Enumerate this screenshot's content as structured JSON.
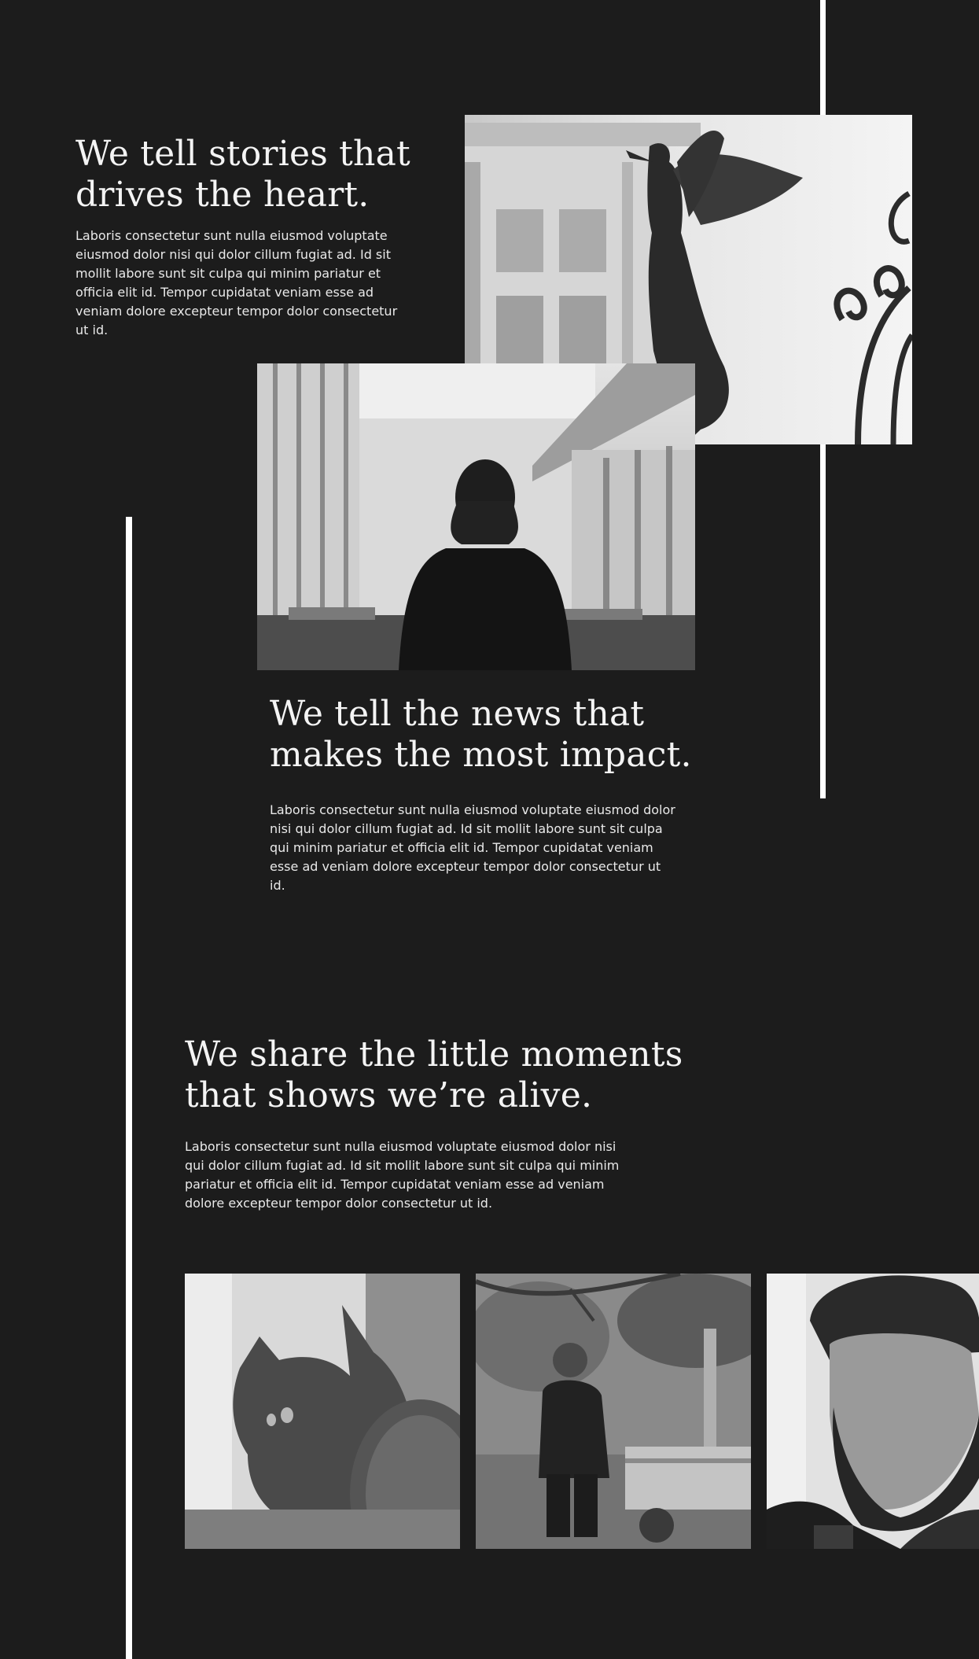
{
  "sections": [
    {
      "heading_line1": "We tell stories that",
      "heading_line2": "drives the heart.",
      "body": "Laboris consectetur sunt nulla eiusmod voluptate eiusmod dolor nisi qui dolor cillum fugiat ad. Id sit mollit labore sunt sit culpa qui minim pariatur et officia elit id. Tempor cupidatat veniam esse ad veniam dolore excepteur tempor dolor consectetur ut id."
    },
    {
      "heading_line1": "We tell the news that",
      "heading_line2": "makes the most impact.",
      "body": "Laboris consectetur sunt nulla eiusmod voluptate eiusmod dolor nisi qui dolor cillum fugiat ad. Id sit mollit labore sunt sit culpa qui minim pariatur et officia elit id. Tempor cupidatat veniam esse ad veniam dolore excepteur tempor dolor consectetur ut id."
    },
    {
      "heading_line1": "We share the little moments",
      "heading_line2": "that shows we’re alive.",
      "body": "Laboris consectetur sunt nulla eiusmod voluptate eiusmod dolor nisi qui dolor cillum fugiat ad. Id sit mollit labore sunt sit culpa qui minim pariatur et officia elit id. Tempor cupidatat veniam esse ad veniam dolore excepteur tempor dolor consectetur ut id."
    }
  ],
  "images": {
    "angel": "angel-statue-photo",
    "interior": "person-in-hall-photo",
    "cat": "cat-photo",
    "child": "child-with-cart-photo",
    "man": "bearded-man-photo"
  },
  "colors": {
    "background": "#1c1c1c",
    "lines": "#ffffff",
    "text": "#f2f2f2"
  }
}
